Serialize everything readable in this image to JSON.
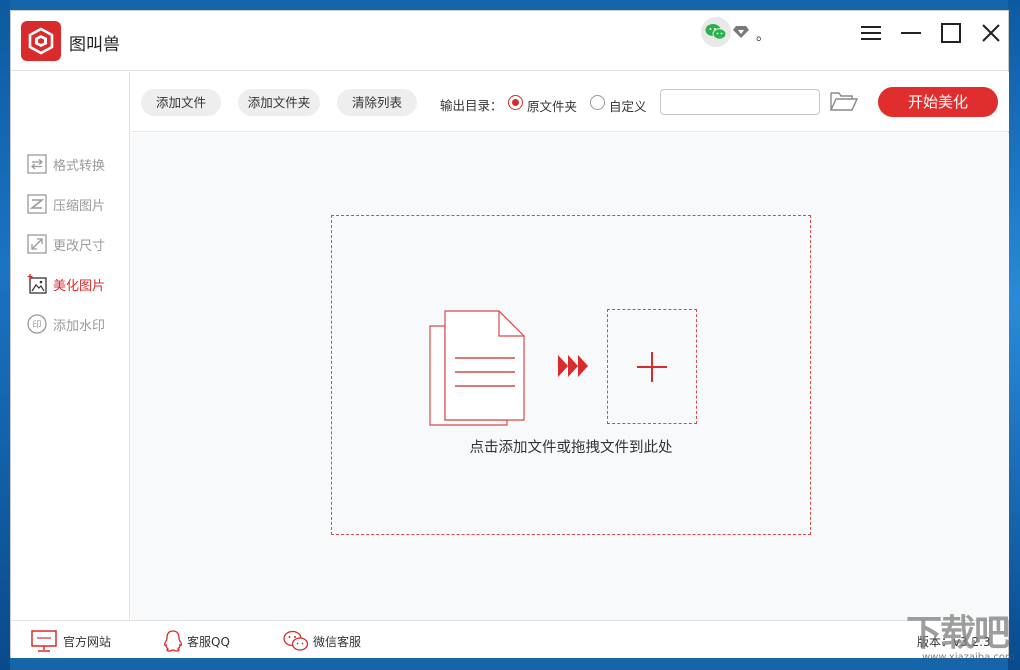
{
  "app": {
    "title": "图叫兽",
    "user_name": "。",
    "accent_color": "#e02e2e"
  },
  "sidebar": {
    "items": [
      {
        "label": "格式转换",
        "icon": "format-convert-icon",
        "active": false
      },
      {
        "label": "压缩图片",
        "icon": "compress-icon",
        "active": false
      },
      {
        "label": "更改尺寸",
        "icon": "resize-icon",
        "active": false
      },
      {
        "label": "美化图片",
        "icon": "beautify-icon",
        "active": true
      },
      {
        "label": "添加水印",
        "icon": "watermark-icon",
        "active": false
      }
    ]
  },
  "toolbar": {
    "add_file": "添加文件",
    "add_folder": "添加文件夹",
    "clear_list": "清除列表",
    "output_label": "输出目录：",
    "option_original": "原文件夹",
    "option_custom": "自定义",
    "selected_option": "原文件夹",
    "path_value": "",
    "start_button": "开始美化"
  },
  "content": {
    "drop_hint": "点击添加文件或拖拽文件到此处"
  },
  "footer": {
    "official_site": "官方网站",
    "qq_support": "客服QQ",
    "wechat_support": "微信客服",
    "version": "版本：v3.2.3"
  },
  "watermark": {
    "text": "下载吧",
    "url": "www.xiazaiba.com"
  }
}
